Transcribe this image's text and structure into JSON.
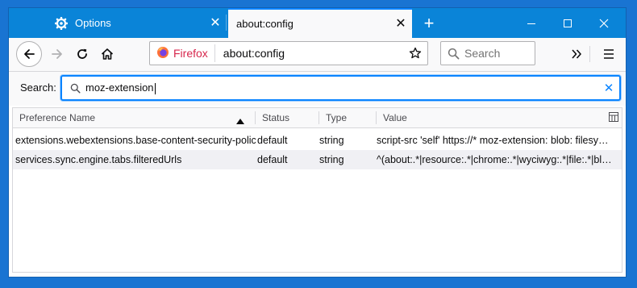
{
  "tabs": [
    {
      "label": "Options",
      "icon": "gear-icon",
      "close": "✕"
    },
    {
      "label": "about:config",
      "close": "✕"
    }
  ],
  "newtab_label": "+",
  "navbar": {
    "identity_label": "Firefox",
    "url": "about:config",
    "search_placeholder": "Search"
  },
  "filter": {
    "label": "Search:",
    "value": "moz-extension"
  },
  "table": {
    "columns": [
      "Preference Name",
      "Status",
      "Type",
      "Value"
    ],
    "rows": [
      {
        "name": "extensions.webextensions.base-content-security-policy",
        "status": "default",
        "type": "string",
        "value": "script-src 'self' https://* moz-extension: blob: filesyst..."
      },
      {
        "name": "services.sync.engine.tabs.filteredUrls",
        "status": "default",
        "type": "string",
        "value": "^(about:.*|resource:.*|chrome:.*|wyciwyg:.*|file:.*|blo..."
      }
    ]
  },
  "colors": {
    "desktop": "#1974d2",
    "titlebar": "#0a84d8",
    "accent": "#0a84ff",
    "firefox_label": "#d7264c"
  }
}
